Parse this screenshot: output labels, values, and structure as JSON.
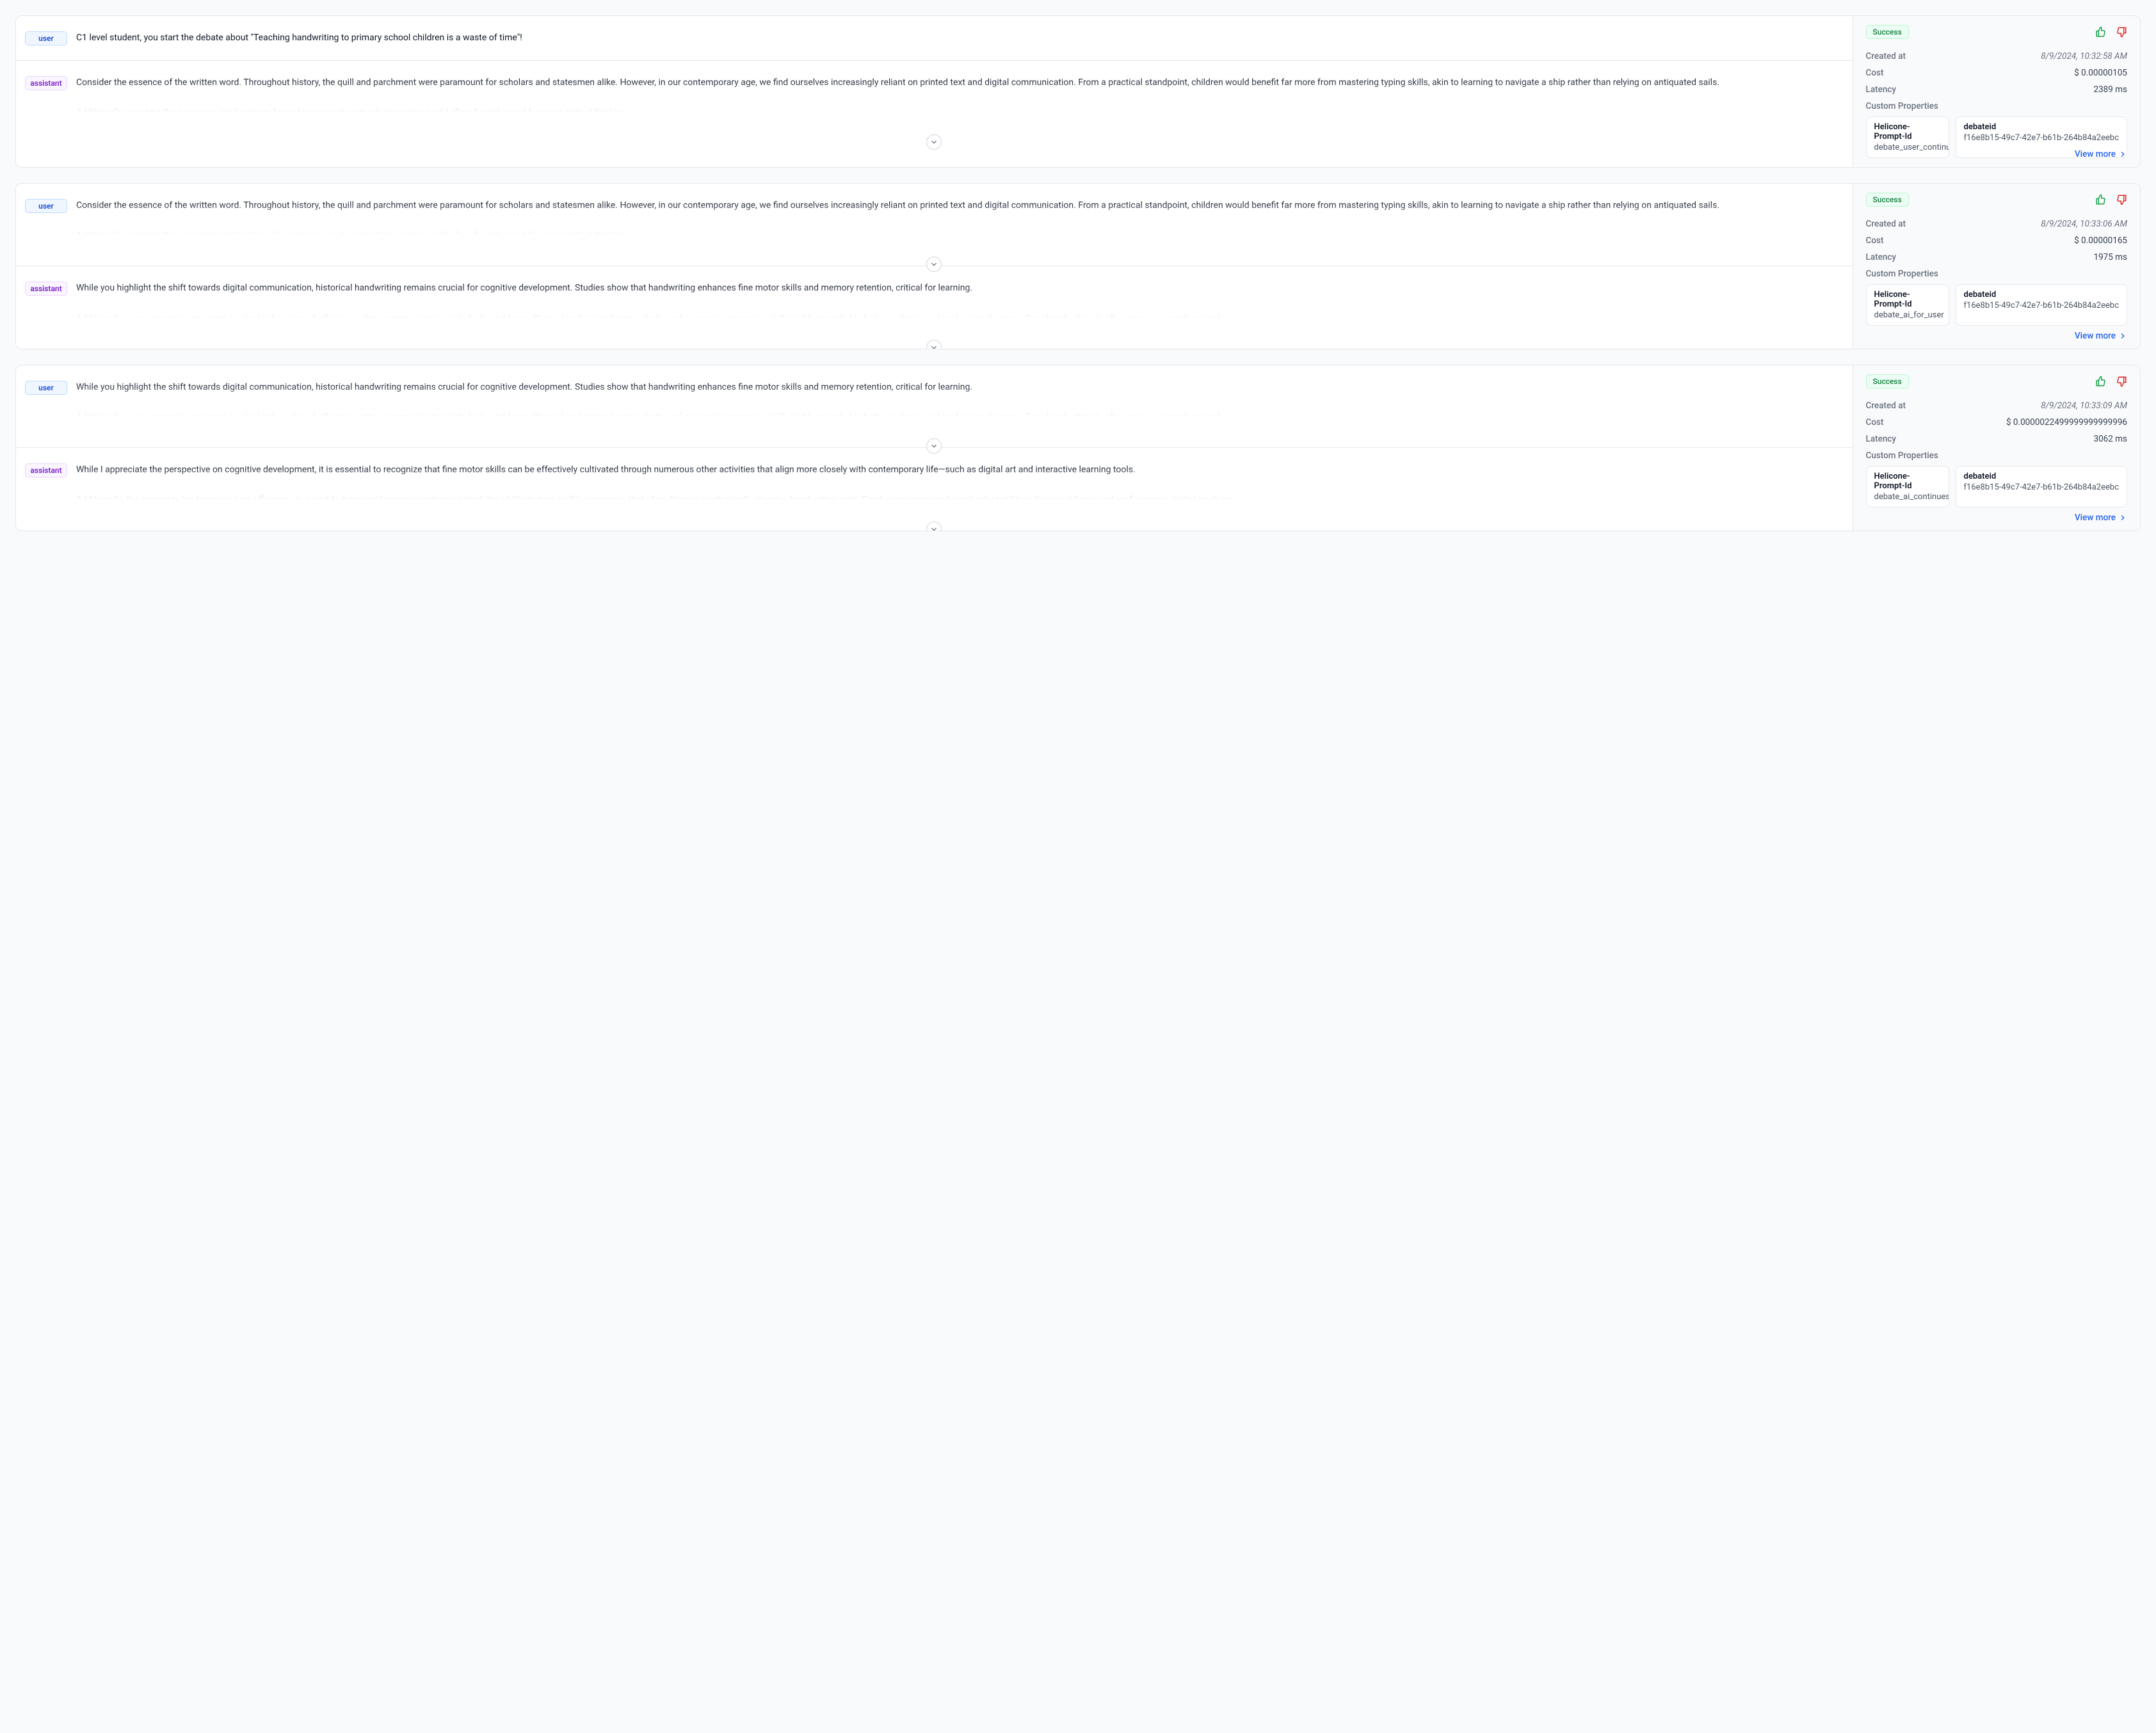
{
  "labels": {
    "user": "user",
    "assistant": "assistant",
    "success": "Success",
    "created_at": "Created at",
    "cost": "Cost",
    "latency": "Latency",
    "custom_props": "Custom Properties",
    "helicone_prompt_id": "Helicone-Prompt-Id",
    "debateid": "debateid",
    "view_more": "View more"
  },
  "requests": [
    {
      "messages": [
        {
          "role": "user",
          "text": "C1 level student, you start the debate about \"Teaching handwriting to primary school children is a waste of time\"!",
          "truncated": false
        },
        {
          "role": "assistant",
          "text": "Consider the essence of the written word. Throughout history, the quill and parchment were paramount for scholars and statesmen alike. However, in our contemporary age, we find ourselves increasingly reliant on printed text and digital communication. From a practical standpoint, children would benefit far more from mastering typing skills, akin to learning to navigate a ship rather than relying on antiquated sails.\n\nAdditionally, consider the economic implications: fewer hours spent on teaching cursive could allow for enhanced focus on critical thinking,",
          "truncated": true
        }
      ],
      "meta": {
        "created_at": "8/9/2024, 10:32:58 AM",
        "cost": "$ 0.00000105",
        "latency": "2389 ms",
        "props": {
          "helicone_prompt_id": "debate_user_continues",
          "debateid": "f16e8b15-49c7-42e7-b61b-264b84a2eebc"
        }
      },
      "view_more": true
    },
    {
      "messages": [
        {
          "role": "user",
          "text": "Consider the essence of the written word. Throughout history, the quill and parchment were paramount for scholars and statesmen alike. However, in our contemporary age, we find ourselves increasingly reliant on printed text and digital communication. From a practical standpoint, children would benefit far more from mastering typing skills, akin to learning to navigate a ship rather than relying on antiquated sails.\n\nAdditionally, consider the economic implications: fewer hours spent on teaching cursive could allow for enhanced focus on critical thinking,",
          "truncated": true
        },
        {
          "role": "assistant",
          "text": "While you highlight the shift towards digital communication, historical handwriting remains crucial for cognitive development. Studies show that handwriting enhances fine motor skills and memory retention, critical for learning.\n\nAdditionally, your economic argument overlooks the value of effective written communication in today's workforce. Strong handwriting fosters clarity and personal expression, skills highly regarded in both academic and professional arenas. Poor handwriting is often seen as unprofessional,",
          "truncated": true
        }
      ],
      "meta": {
        "created_at": "8/9/2024, 10:33:06 AM",
        "cost": "$ 0.00000165",
        "latency": "1975 ms",
        "props": {
          "helicone_prompt_id": "debate_ai_for_user",
          "debateid": "f16e8b15-49c7-42e7-b61b-264b84a2eebc"
        }
      },
      "view_more": true
    },
    {
      "messages": [
        {
          "role": "user",
          "text": "While you highlight the shift towards digital communication, historical handwriting remains crucial for cognitive development. Studies show that handwriting enhances fine motor skills and memory retention, critical for learning.\n\nAdditionally, your economic argument overlooks the value of effective written communication in today's workforce. Strong handwriting fosters clarity and personal expression, skills highly regarded in both academic and professional arenas. Poor handwriting is often seen as unprofessional,",
          "truncated": true
        },
        {
          "role": "assistant",
          "text": "While I appreciate the perspective on cognitive development, it is essential to recognize that fine motor skills can be effectively cultivated through numerous other activities that align more closely with contemporary life—such as digital art and interactive learning tools.\n\nAdditionally, the corporate landscape values efficiency. In a world where rapid communication is prized, the ability to type swiftly surpasses that of crafting an aesthetically pleasing handwritten note. Employers increasingly seek adaptability in their workforce, and proficiency in digital mediums",
          "truncated": true
        }
      ],
      "meta": {
        "created_at": "8/9/2024, 10:33:09 AM",
        "cost": "$ 0.0000022499999999999996",
        "latency": "3062 ms",
        "props": {
          "helicone_prompt_id": "debate_ai_continues",
          "debateid": "f16e8b15-49c7-42e7-b61b-264b84a2eebc"
        }
      },
      "view_more": true
    }
  ]
}
